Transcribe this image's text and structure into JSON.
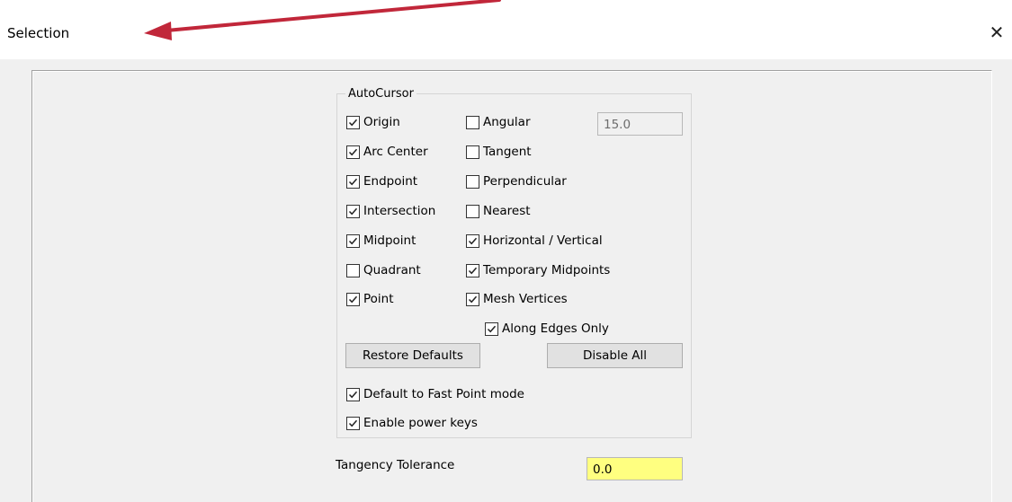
{
  "window": {
    "title": "Selection",
    "close_glyph": "✕"
  },
  "annotation": {
    "arrow_color": "#c1273a"
  },
  "autocursor": {
    "label": "AutoCursor",
    "left_column": [
      {
        "label": "Origin",
        "checked": true
      },
      {
        "label": "Arc Center",
        "checked": true
      },
      {
        "label": "Endpoint",
        "checked": true
      },
      {
        "label": "Intersection",
        "checked": true
      },
      {
        "label": "Midpoint",
        "checked": true
      },
      {
        "label": "Quadrant",
        "checked": false
      },
      {
        "label": "Point",
        "checked": true
      }
    ],
    "right_column": [
      {
        "label": "Angular",
        "checked": false
      },
      {
        "label": "Tangent",
        "checked": false
      },
      {
        "label": "Perpendicular",
        "checked": false
      },
      {
        "label": "Nearest",
        "checked": false
      },
      {
        "label": "Horizontal / Vertical",
        "checked": true
      },
      {
        "label": "Temporary Midpoints",
        "checked": true
      },
      {
        "label": "Mesh Vertices",
        "checked": true
      }
    ],
    "angular_value": "15.0",
    "along_edges": {
      "label": "Along Edges Only",
      "checked": true
    },
    "restore_defaults_label": "Restore Defaults",
    "disable_all_label": "Disable All",
    "fast_point": {
      "label": "Default to Fast Point mode",
      "checked": true
    },
    "power_keys": {
      "label": "Enable power keys",
      "checked": true
    }
  },
  "tangency": {
    "label": "Tangency Tolerance",
    "value": "0.0",
    "field_color": "#ffff80"
  }
}
